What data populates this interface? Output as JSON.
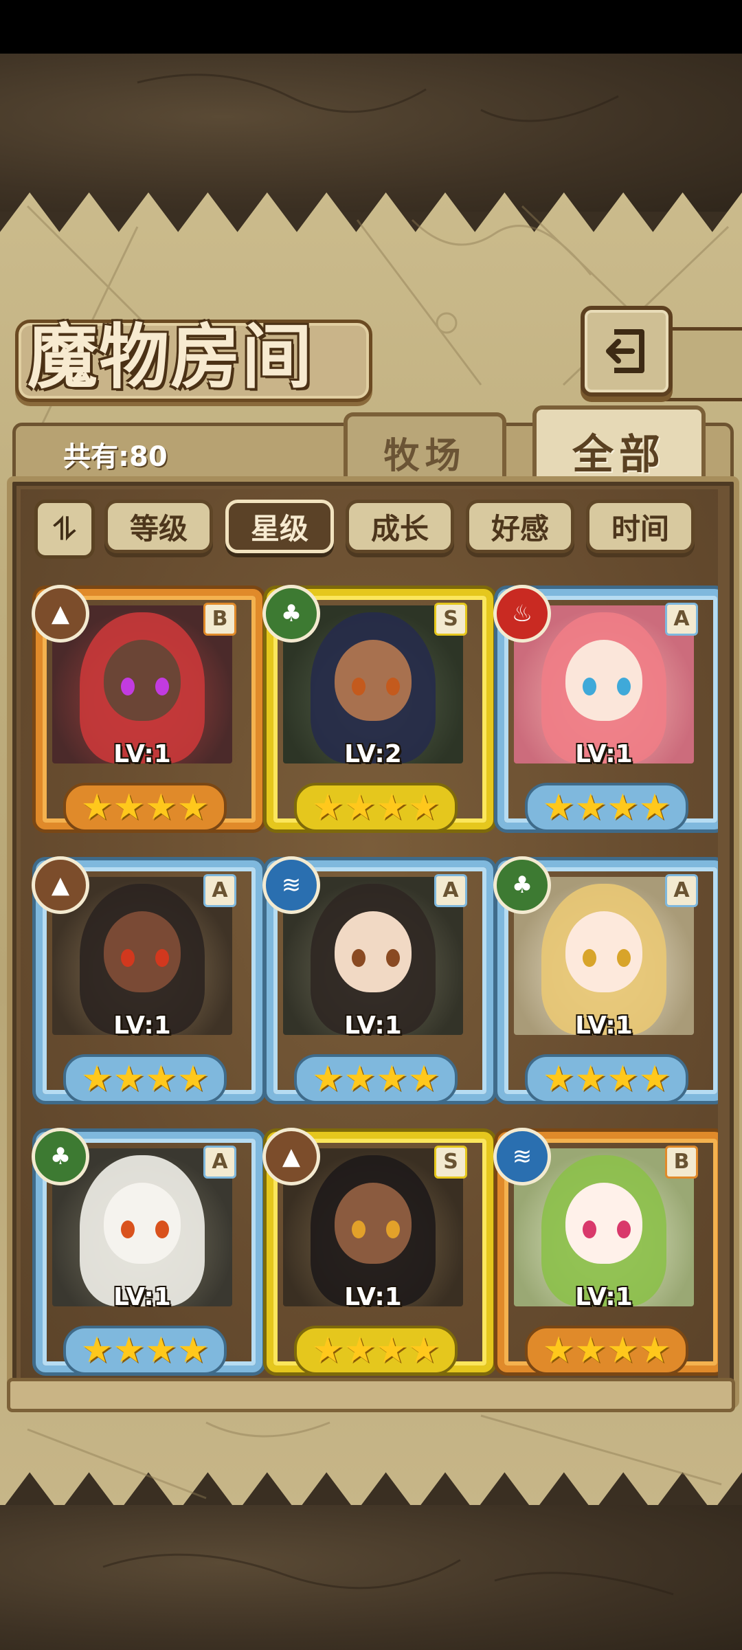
{
  "header": {
    "title": "魔物房间",
    "back_icon": "back-arrow-icon"
  },
  "tabs": {
    "count_label": "共有:80",
    "ranch": "牧场",
    "all": "全部",
    "selected": "all"
  },
  "filters": {
    "sort_icon": "sort-toggle-icon",
    "sort_glyph": "⥮",
    "items": [
      "等级",
      "星级",
      "成长",
      "好感",
      "时间"
    ],
    "active": "星级"
  },
  "monsters": [
    {
      "rank": "B",
      "element": "earth",
      "element_glyph": "▲",
      "level": "LV:1",
      "stars": "★★★★",
      "frame": "orange"
    },
    {
      "rank": "S",
      "element": "grass",
      "element_glyph": "♣",
      "level": "LV:2",
      "stars": "★★★★",
      "frame": "gold"
    },
    {
      "rank": "A",
      "element": "fire",
      "element_glyph": "♨",
      "level": "LV:1",
      "stars": "★★★★",
      "frame": "blue"
    },
    {
      "rank": "A",
      "element": "earth",
      "element_glyph": "▲",
      "level": "LV:1",
      "stars": "★★★★",
      "frame": "blue"
    },
    {
      "rank": "A",
      "element": "water",
      "element_glyph": "≋",
      "level": "LV:1",
      "stars": "★★★★",
      "frame": "blue"
    },
    {
      "rank": "A",
      "element": "grass",
      "element_glyph": "♣",
      "level": "LV:1",
      "stars": "★★★★",
      "frame": "blue"
    },
    {
      "rank": "A",
      "element": "grass",
      "element_glyph": "♣",
      "level": "LV:1",
      "stars": "★★★★",
      "frame": "blue"
    },
    {
      "rank": "S",
      "element": "earth",
      "element_glyph": "▲",
      "level": "LV:1",
      "stars": "★★★★",
      "frame": "gold"
    },
    {
      "rank": "B",
      "element": "water",
      "element_glyph": "≋",
      "level": "LV:1",
      "stars": "★★★★",
      "frame": "orange"
    }
  ],
  "colors": {
    "parchment": "#c2b183",
    "panel": "#6e5334",
    "star": "#ffc81c"
  }
}
